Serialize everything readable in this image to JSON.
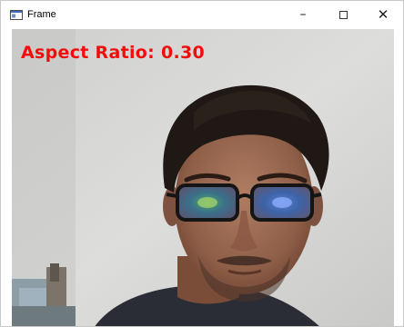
{
  "window": {
    "title": "Frame",
    "app_icon": "window-app-icon",
    "controls": {
      "minimize_glyph": "–",
      "close_glyph": "✕"
    }
  },
  "frame": {
    "overlay_label": "Aspect Ratio: 0.30",
    "overlay_color": "#f20d0d"
  }
}
